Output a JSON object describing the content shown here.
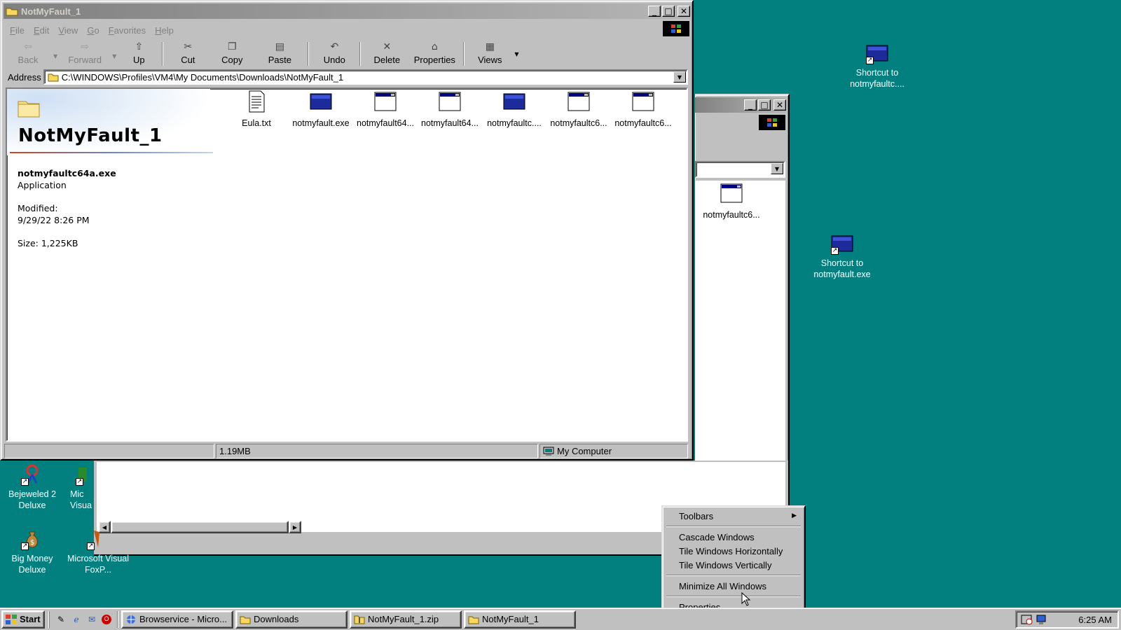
{
  "main_window": {
    "title": "NotMyFault_1",
    "menu": [
      "File",
      "Edit",
      "View",
      "Go",
      "Favorites",
      "Help"
    ],
    "toolbar": {
      "back": "Back",
      "forward": "Forward",
      "up": "Up",
      "cut": "Cut",
      "copy": "Copy",
      "paste": "Paste",
      "undo": "Undo",
      "delete": "Delete",
      "properties": "Properties",
      "views": "Views"
    },
    "address_label": "Address",
    "address_value": "C:\\WINDOWS\\Profiles\\VM4\\My Documents\\Downloads\\NotMyFault_1",
    "folder_heading": "NotMyFault_1",
    "selected_file": {
      "name": "notmyfaultc64a.exe",
      "type": "Application",
      "modified_label": "Modified:",
      "modified_value": "9/29/22 8:26 PM",
      "size": "Size: 1,225KB"
    },
    "files": [
      {
        "name": "Eula.txt",
        "icon": "text-file-icon"
      },
      {
        "name": "notmyfault.exe",
        "icon": "app-exe-icon"
      },
      {
        "name": "notmyfault64...",
        "icon": "window-app-icon"
      },
      {
        "name": "notmyfault64...",
        "icon": "window-app-icon"
      },
      {
        "name": "notmyfaultc....",
        "icon": "app-exe-icon"
      },
      {
        "name": "notmyfaultc6...",
        "icon": "window-app-icon"
      },
      {
        "name": "notmyfaultc6...",
        "icon": "window-app-icon"
      }
    ],
    "status": {
      "size": "1.19MB",
      "zone": "My Computer"
    }
  },
  "back_window": {
    "file_label": "notmyfaultc6..."
  },
  "desktop_icons": {
    "shortcut1": "Shortcut to notmyfaultc....",
    "shortcut2": "Shortcut to notmyfault.exe",
    "bejeweled": "Bejeweled 2 Deluxe",
    "mic_visual": "Mic Visua",
    "big_money": "Big Money Deluxe",
    "visual_foxpro": "Microsoft Visual FoxP..."
  },
  "context_menu": {
    "toolbars": "Toolbars",
    "cascade": "Cascade Windows",
    "tile_h": "Tile Windows Horizontally",
    "tile_v": "Tile Windows Vertically",
    "minimize_all": "Minimize All Windows",
    "properties": "Properties"
  },
  "taskbar": {
    "start": "Start",
    "buttons": [
      "Browservice - Micro...",
      "Downloads",
      "NotMyFault_1.zip",
      "NotMyFault_1"
    ],
    "clock": "6:25 AM"
  },
  "colors": {
    "desktop": "#028080",
    "face": "#c0c0c0",
    "inactive_title": "#808080"
  }
}
